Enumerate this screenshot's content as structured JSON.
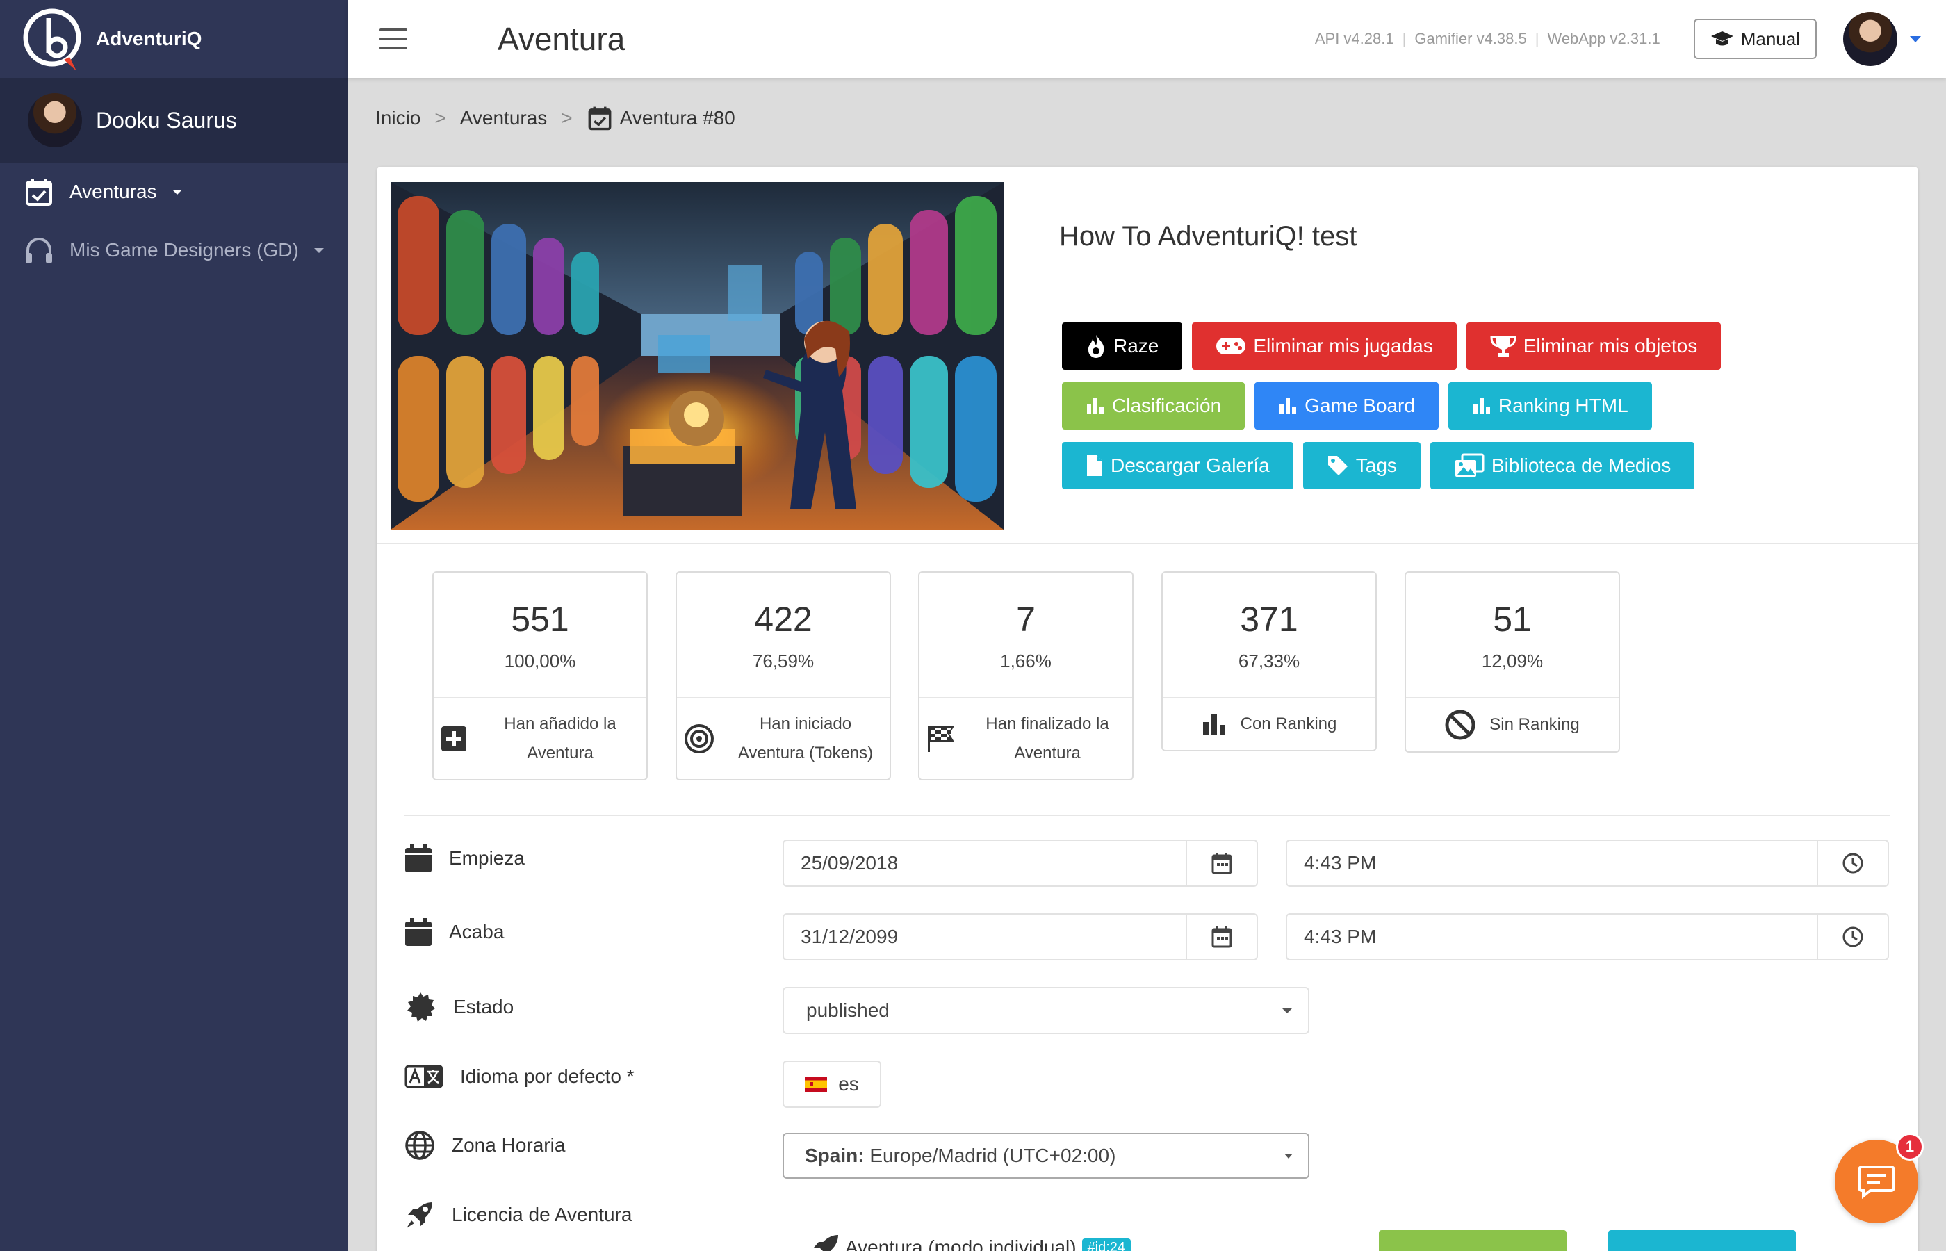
{
  "brand": {
    "name": "AdventuriQ"
  },
  "sidebar": {
    "user_name": "Dooku Saurus",
    "items": [
      {
        "label": "Aventuras",
        "icon": "calendar-check-icon"
      },
      {
        "label": "Mis Game Designers (GD)",
        "icon": "headphones-icon"
      }
    ]
  },
  "topbar": {
    "title": "Aventura",
    "versions": [
      "API v4.28.1",
      "Gamifier v4.38.5",
      "WebApp v2.31.1"
    ],
    "manual_label": "Manual"
  },
  "breadcrumb": {
    "items": [
      "Inicio",
      "Aventuras",
      "Aventura #80"
    ],
    "separator": ">"
  },
  "adventure": {
    "title": "How To AdventuriQ! test",
    "buttons": [
      {
        "label": "Raze",
        "icon": "fire-icon",
        "color": "#000000"
      },
      {
        "label": "Eliminar mis jugadas",
        "icon": "gamepad-icon",
        "color": "#e0302f"
      },
      {
        "label": "Eliminar mis objetos",
        "icon": "trophy-icon",
        "color": "#e0302f"
      },
      {
        "label": "Clasificación",
        "icon": "bar-chart-icon",
        "color": "#8bc34a"
      },
      {
        "label": "Game Board",
        "icon": "bar-chart-icon",
        "color": "#2f86f6"
      },
      {
        "label": "Ranking HTML",
        "icon": "bar-chart-icon",
        "color": "#1bb6d1"
      },
      {
        "label": "Descargar Galería",
        "icon": "file-icon",
        "color": "#1bb6d1"
      },
      {
        "label": "Tags",
        "icon": "tag-icon",
        "color": "#1bb6d1"
      },
      {
        "label": "Biblioteca de Medios",
        "icon": "images-icon",
        "color": "#1bb6d1"
      }
    ]
  },
  "stats": [
    {
      "value": "551",
      "percent": "100,00%",
      "label": "Han añadido la Aventura",
      "icon": "plus-square-icon"
    },
    {
      "value": "422",
      "percent": "76,59%",
      "label": "Han iniciado Aventura (Tokens)",
      "icon": "target-icon"
    },
    {
      "value": "7",
      "percent": "1,66%",
      "label": "Han finalizado la Aventura",
      "icon": "checkered-flag-icon"
    },
    {
      "value": "371",
      "percent": "67,33%",
      "label": "Con Ranking",
      "icon": "bar-chart-icon"
    },
    {
      "value": "51",
      "percent": "12,09%",
      "label": "Sin Ranking",
      "icon": "ban-icon"
    }
  ],
  "form": {
    "start": {
      "label": "Empieza",
      "date": "25/09/2018",
      "time": "4:43 PM"
    },
    "end": {
      "label": "Acaba",
      "date": "31/12/2099",
      "time": "4:43 PM"
    },
    "status": {
      "label": "Estado",
      "value": "published"
    },
    "language": {
      "label": "Idioma por defecto *",
      "value": "es"
    },
    "timezone": {
      "label": "Zona Horaria",
      "value_bold": "Spain:",
      "value": "Europe/Madrid (UTC+02:00)"
    },
    "license": {
      "label": "Licencia de Aventura",
      "value": "Aventura (modo individual)",
      "badge": "#id:24"
    }
  },
  "chat": {
    "badge_count": "1"
  }
}
